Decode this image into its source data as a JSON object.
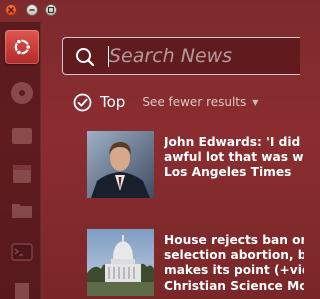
{
  "window": {
    "buttons": [
      "close",
      "minimize",
      "maximize"
    ]
  },
  "launcher": {
    "items": [
      "ubuntu-logo-icon",
      "disc-icon",
      "files-icon",
      "calendar-icon",
      "folder-icon",
      "terminal-icon",
      "document-icon"
    ]
  },
  "search": {
    "placeholder": "Search News",
    "value": ""
  },
  "category": {
    "title": "Top",
    "toggle_label": "See fewer results",
    "toggle_icon": "triangle-down-icon"
  },
  "results": [
    {
      "lines": [
        "John Edwards: 'I did an",
        "awful lot that was wro",
        "Los Angeles Times"
      ],
      "thumb_icon": "portrait-photo"
    },
    {
      "lines": [
        "House rejects ban on",
        "selection abortion, bu",
        "makes its point (+vide",
        "Christian Science Mon"
      ],
      "thumb_icon": "capitol-photo"
    }
  ],
  "colors": {
    "background": "#842b2e",
    "launcher_bfb": "#c73a35",
    "text": "#ffffff"
  }
}
